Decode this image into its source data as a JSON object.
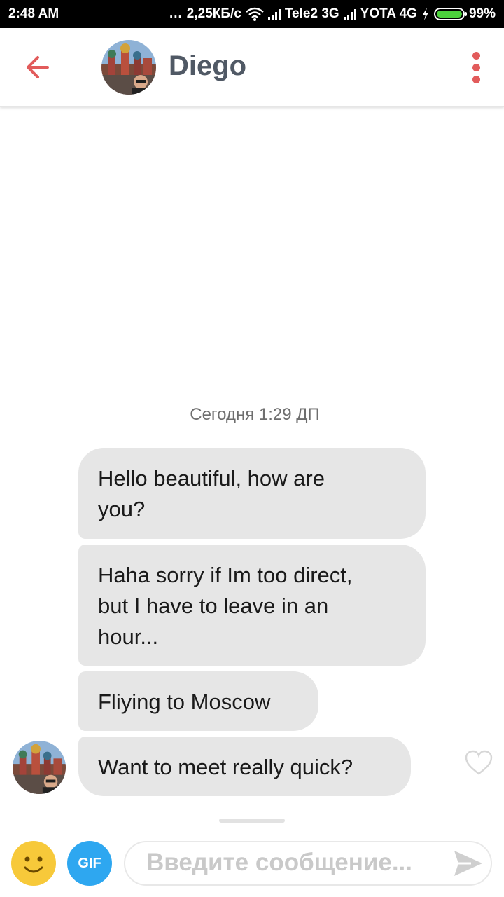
{
  "status_bar": {
    "time": "2:48 AM",
    "dots": "...",
    "speed": "2,25КБ/с",
    "carrier1": "Tele2 3G",
    "carrier2": "YOTA 4G",
    "battery_text": "99%",
    "battery_level": 0.99,
    "battery_color": "#4cd23c",
    "icons": [
      "wifi-icon",
      "signal-icon",
      "charging-icon",
      "battery-icon"
    ]
  },
  "header": {
    "name": "Diego",
    "back_icon": "arrow-left-icon",
    "more_icon": "more-vertical-icon",
    "accent_color": "#e25b5b"
  },
  "conversation": {
    "timestamp": "Сегодня 1:29 ДП",
    "messages": [
      {
        "line1": "Hello beautiful, how are",
        "line2": "you?"
      },
      {
        "line1": "Haha sorry if Im too direct,",
        "line2": "but I have to leave in an",
        "line3": "hour..."
      },
      {
        "line1": "Fliying to Moscow"
      },
      {
        "line1": "Want to meet really quick?"
      }
    ]
  },
  "composer": {
    "emoji_icon": "smiley-icon",
    "gif_label": "GIF",
    "placeholder": "Введите сообщение...",
    "send_icon": "send-icon",
    "gif_color": "#2ea7f0",
    "emoji_color": "#f7c93a"
  }
}
